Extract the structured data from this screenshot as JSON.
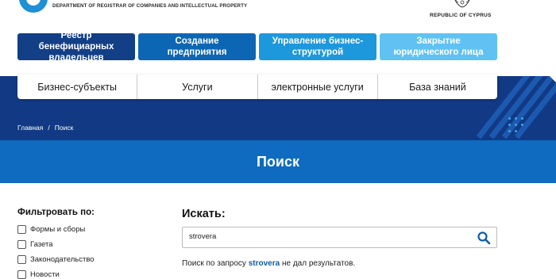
{
  "header": {
    "department": "DEPARTMENT OF REGISTRAR OF COMPANIES AND INTELLECTUAL PROPERTY",
    "republic": "REPUBLIC OF CYPRUS"
  },
  "top_buttons": [
    {
      "label": "Реестр бенефициарных владельцев",
      "color": "#123f86"
    },
    {
      "label": "Создание предприятия",
      "color": "#0d66b3"
    },
    {
      "label": "Управление бизнес-структурой",
      "color": "#1d98dc"
    },
    {
      "label": "Закрытие юридического лица",
      "color": "#5fc2f2"
    }
  ],
  "nav": [
    {
      "label": "Бизнес-субъекты"
    },
    {
      "label": "Услуги"
    },
    {
      "label": "электронные услуги"
    },
    {
      "label": "База знаний"
    }
  ],
  "breadcrumb": {
    "home": "Главная",
    "separator": "/",
    "current": "Поиск"
  },
  "page_title": "Поиск",
  "filters": {
    "title": "Фильтровать по:",
    "items": [
      {
        "label": "Формы и сборы",
        "checked": false
      },
      {
        "label": "Газета",
        "checked": false
      },
      {
        "label": "Законодательство",
        "checked": false
      },
      {
        "label": "Новости",
        "checked": false
      }
    ]
  },
  "search": {
    "title": "Искать:",
    "value": "strovera",
    "result_prefix": "Поиск по запросу ",
    "result_query": "strovera",
    "result_suffix": " не дал результатов."
  },
  "colors": {
    "dark_band": "#123a84",
    "title_band": "#0e6bbf",
    "link": "#0e5ea8"
  }
}
